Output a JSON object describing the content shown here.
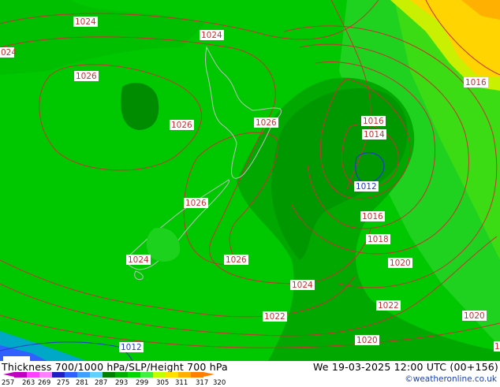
{
  "title": "Thickness 700/1000 hPa/SLP/Height 700 hPa",
  "datetime": "We 19-03-2025 12:00 UTC (00+156)",
  "credit": "©weatheronline.co.uk",
  "legend": {
    "ticks": [
      "257",
      "263",
      "269",
      "275",
      "281",
      "287",
      "293",
      "299",
      "305",
      "311",
      "317",
      "320"
    ],
    "colors": [
      "#c000c0",
      "#ff40ff",
      "#ff80ff",
      "#2020c0",
      "#3060ff",
      "#40a0ff",
      "#60d0ff",
      "#008000",
      "#00b000",
      "#00d800",
      "#40f040",
      "#c0ff00",
      "#ffe000",
      "#ffb000",
      "#ff8000"
    ]
  },
  "isobar_labels": [
    {
      "text": "1024",
      "color": "#c83232"
    },
    {
      "text": "1024",
      "color": "#c83232"
    },
    {
      "text": "024",
      "color": "#c83232"
    },
    {
      "text": "1026",
      "color": "#c83232"
    },
    {
      "text": "1026",
      "color": "#c83232"
    },
    {
      "text": "1026",
      "color": "#c83232"
    },
    {
      "text": "1026",
      "color": "#c83232"
    },
    {
      "text": "1024",
      "color": "#c83232"
    },
    {
      "text": "1026",
      "color": "#c83232"
    },
    {
      "text": "1024",
      "color": "#c83232"
    },
    {
      "text": "1022",
      "color": "#c83232"
    },
    {
      "text": "1016",
      "color": "#c83232"
    },
    {
      "text": "1016",
      "color": "#c83232"
    },
    {
      "text": "1014",
      "color": "#c83232"
    },
    {
      "text": "1012",
      "color": "#1e3cc8"
    },
    {
      "text": "1016",
      "color": "#c83232"
    },
    {
      "text": "1018",
      "color": "#c83232"
    },
    {
      "text": "1020",
      "color": "#c83232"
    },
    {
      "text": "1022",
      "color": "#c83232"
    },
    {
      "text": "1020",
      "color": "#c83232"
    },
    {
      "text": "1020",
      "color": "#c83232"
    },
    {
      "text": "1012",
      "color": "#1e3cc8"
    },
    {
      "text": "1",
      "color": "#c83232"
    }
  ]
}
